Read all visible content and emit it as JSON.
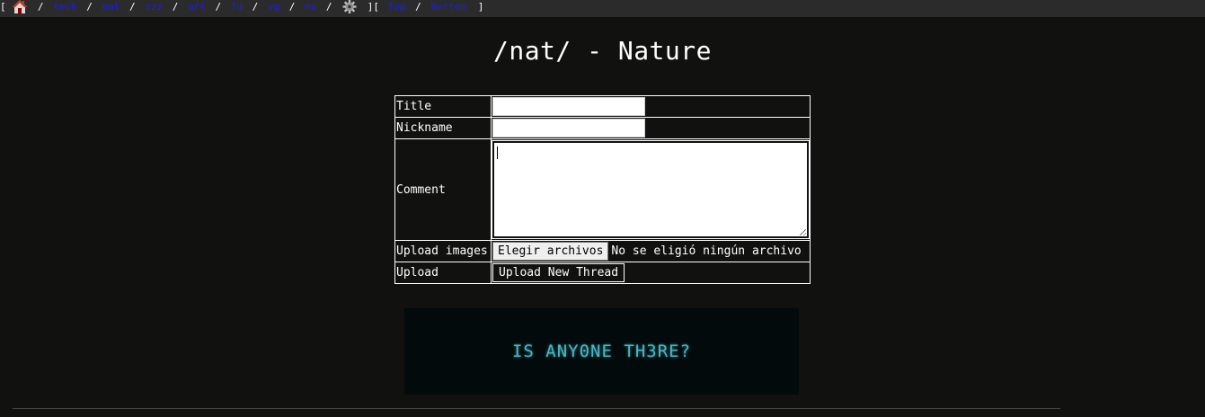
{
  "nav": {
    "open_bracket": "[",
    "boards": [
      "tech",
      "nat",
      "zzz",
      "art",
      "fd",
      "vg",
      "mu"
    ],
    "separator": "/",
    "close_open": "][",
    "top_label": "Top",
    "bottom_label": "Bottom",
    "close_bracket": "]",
    "home_icon": "home-icon",
    "settings_icon": "gear-icon",
    "link_color": "#1a1aff"
  },
  "page": {
    "title": "/nat/ - Nature"
  },
  "form": {
    "title_label": "Title",
    "title_value": "",
    "nickname_label": "Nickname",
    "nickname_value": "",
    "comment_label": "Comment",
    "comment_value": "",
    "upload_images_label": "Upload images",
    "choose_files_label": "Elegir archivos",
    "no_file_text": "No se eligió ningún archivo",
    "upload_label": "Upload",
    "submit_label": "Upload New Thread"
  },
  "banner": {
    "text": "IS ANY0NE TH3RE?",
    "color": "#4fb3bd"
  }
}
